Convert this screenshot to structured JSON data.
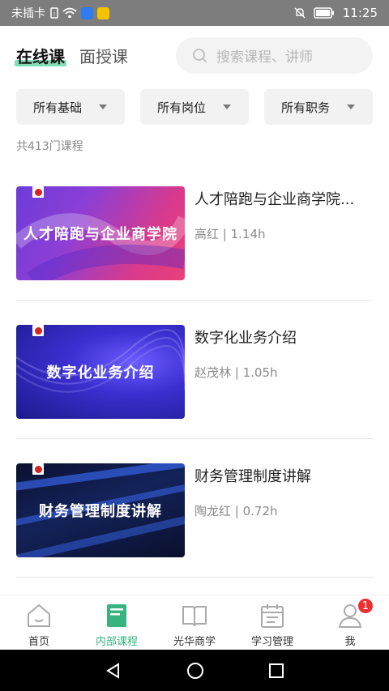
{
  "status_bar": {
    "carrier": "未插卡",
    "time": "11:25",
    "icons": [
      "sim-icon",
      "wifi-icon",
      "notification-app-icon",
      "message-app-icon",
      "mute-icon",
      "battery-icon"
    ]
  },
  "tabs": [
    {
      "label": "在线课",
      "active": true
    },
    {
      "label": "面授课",
      "active": false
    }
  ],
  "search": {
    "placeholder": "搜索课程、讲师"
  },
  "filters": [
    {
      "label": "所有基础"
    },
    {
      "label": "所有岗位"
    },
    {
      "label": "所有职务"
    }
  ],
  "total": "共413门课程",
  "courses": [
    {
      "title": "人才陪跑与企业商学院...",
      "thumb_text": "人才陪跑与企业商学院",
      "meta": "高红 | 1.14h"
    },
    {
      "title": "数字化业务介绍",
      "thumb_text": "数字化业务介绍",
      "meta": "赵茂林 | 1.05h"
    },
    {
      "title": "财务管理制度讲解",
      "thumb_text": "财务管理制度讲解",
      "meta": "陶龙红 | 0.72h"
    }
  ],
  "bottom_nav": [
    {
      "label": "首页",
      "icon": "home-icon",
      "active": false
    },
    {
      "label": "内部课程",
      "icon": "book-icon",
      "active": true
    },
    {
      "label": "光华商学",
      "icon": "open-book-icon",
      "active": false
    },
    {
      "label": "学习管理",
      "icon": "calendar-icon",
      "active": false
    },
    {
      "label": "我",
      "icon": "profile-icon",
      "active": false,
      "badge": "1"
    }
  ],
  "colors": {
    "accent": "#36b37e",
    "tab_highlight": "#58d39b",
    "badge": "#ec2f2f"
  }
}
